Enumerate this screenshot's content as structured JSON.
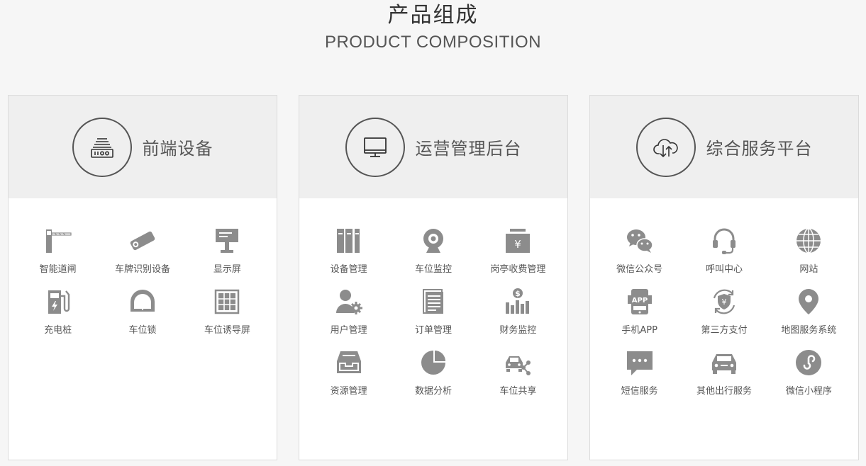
{
  "header": {
    "title": "产品组成",
    "subtitle": "PRODUCT COMPOSITION"
  },
  "colors": {
    "icon": "#8c8c8c",
    "header_bg": "#efefef",
    "circle": "#555555"
  },
  "cards": [
    {
      "title": "前端设备",
      "icon": "barrier-device-icon",
      "items": [
        {
          "label": "智能道闸",
          "icon": "barrier-gate-icon"
        },
        {
          "label": "车牌识别设备",
          "icon": "camera-icon"
        },
        {
          "label": "显示屏",
          "icon": "display-sign-icon"
        },
        {
          "label": "充电桩",
          "icon": "charging-pile-icon"
        },
        {
          "label": "车位锁",
          "icon": "parking-lock-icon"
        },
        {
          "label": "车位诱导屏",
          "icon": "guidance-screen-icon"
        }
      ]
    },
    {
      "title": "运营管理后台",
      "icon": "monitor-icon",
      "items": [
        {
          "label": "设备管理",
          "icon": "binders-icon"
        },
        {
          "label": "车位监控",
          "icon": "webcam-icon"
        },
        {
          "label": "岗亭收费管理",
          "icon": "yuen-box-icon"
        },
        {
          "label": "用户管理",
          "icon": "user-gear-icon"
        },
        {
          "label": "订单管理",
          "icon": "document-icon"
        },
        {
          "label": "财务监控",
          "icon": "finance-chart-icon"
        },
        {
          "label": "资源管理",
          "icon": "inbox-tray-icon"
        },
        {
          "label": "数据分析",
          "icon": "pie-chart-icon"
        },
        {
          "label": "车位共享",
          "icon": "car-share-icon"
        }
      ]
    },
    {
      "title": "综合服务平台",
      "icon": "cloud-sync-icon",
      "items": [
        {
          "label": "微信公众号",
          "icon": "wechat-icon"
        },
        {
          "label": "呼叫中心",
          "icon": "headset-icon"
        },
        {
          "label": "网站",
          "icon": "globe-icon"
        },
        {
          "label": "手机APP",
          "icon": "phone-app-icon"
        },
        {
          "label": "第三方支付",
          "icon": "payment-shield-icon"
        },
        {
          "label": "地图服务系统",
          "icon": "map-pin-icon"
        },
        {
          "label": "短信服务",
          "icon": "sms-icon"
        },
        {
          "label": "其他出行服务",
          "icon": "car-icon"
        },
        {
          "label": "微信小程序",
          "icon": "mini-program-icon"
        }
      ]
    }
  ]
}
